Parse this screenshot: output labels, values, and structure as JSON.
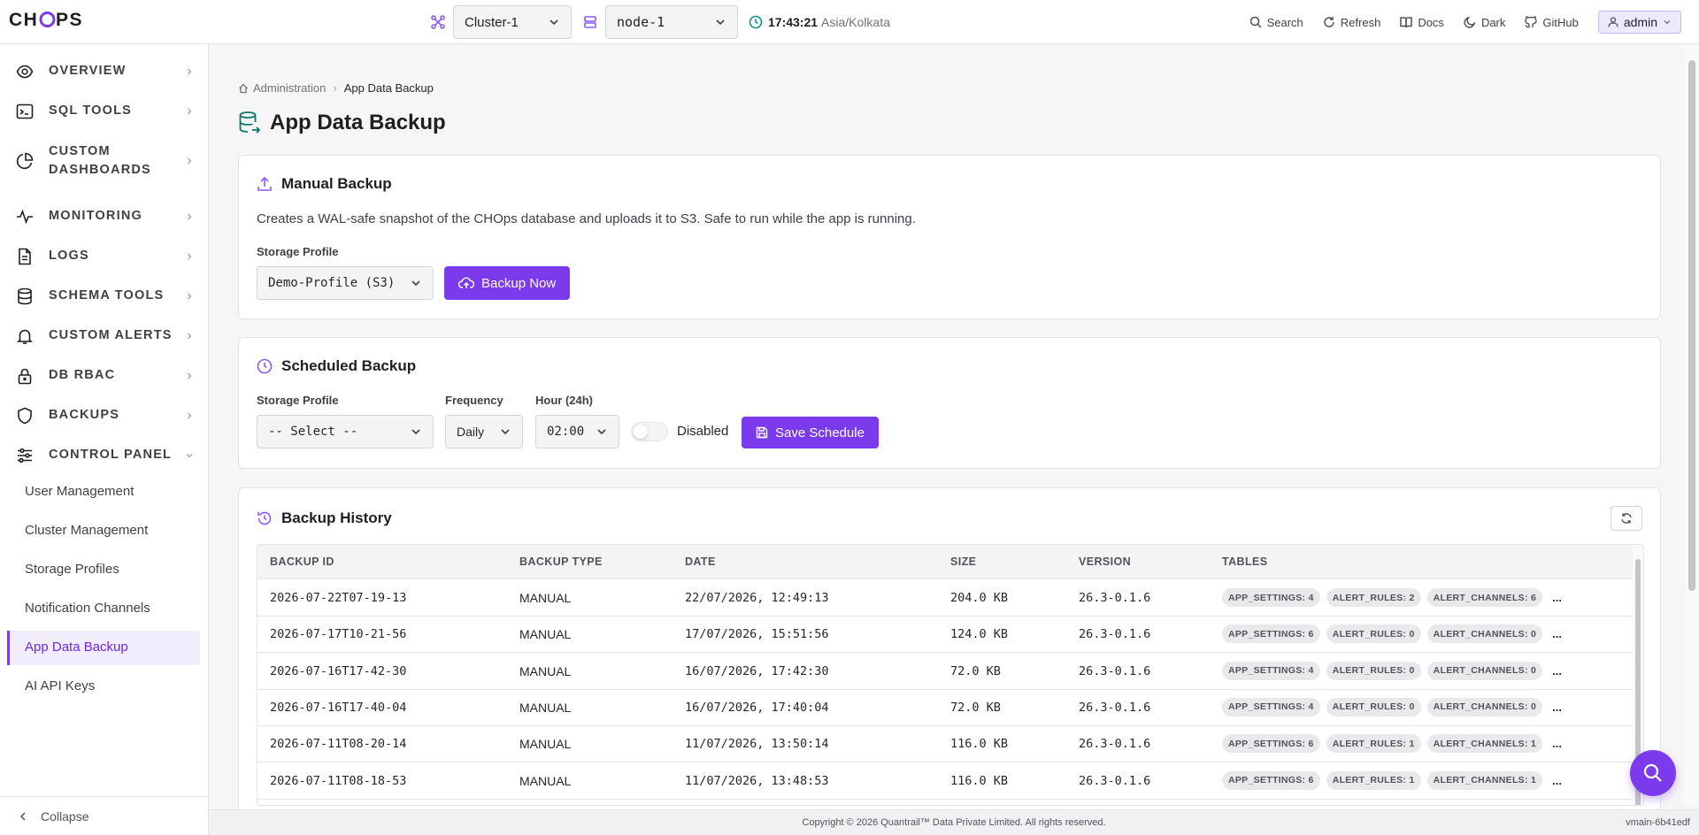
{
  "header": {
    "cluster_select": "Cluster-1",
    "node_select": "node-1",
    "time": "17:43:21",
    "timezone": "Asia/Kolkata",
    "links": {
      "search": "Search",
      "refresh": "Refresh",
      "docs": "Docs",
      "theme": "Dark",
      "github": "GitHub"
    },
    "user": "admin"
  },
  "sidebar": {
    "items": [
      {
        "label": "OVERVIEW",
        "icon": "eye-icon"
      },
      {
        "label": "SQL TOOLS",
        "icon": "terminal-icon"
      },
      {
        "label": "CUSTOM DASHBOARDS",
        "icon": "pie-chart-icon"
      },
      {
        "label": "MONITORING",
        "icon": "activity-icon"
      },
      {
        "label": "LOGS",
        "icon": "file-text-icon"
      },
      {
        "label": "SCHEMA TOOLS",
        "icon": "database-icon"
      },
      {
        "label": "CUSTOM ALERTS",
        "icon": "bell-icon"
      },
      {
        "label": "DB RBAC",
        "icon": "lock-icon"
      },
      {
        "label": "BACKUPS",
        "icon": "shield-icon"
      },
      {
        "label": "CONTROL PANEL",
        "icon": "sliders-icon"
      }
    ],
    "sub_items": [
      {
        "label": "User Management"
      },
      {
        "label": "Cluster Management"
      },
      {
        "label": "Storage Profiles"
      },
      {
        "label": "Notification Channels"
      },
      {
        "label": "App Data Backup"
      },
      {
        "label": "AI API Keys"
      }
    ],
    "collapse": "Collapse"
  },
  "breadcrumb": {
    "parent": "Administration",
    "current": "App Data Backup"
  },
  "page": {
    "title": "App Data Backup"
  },
  "manual": {
    "title": "Manual Backup",
    "description": "Creates a WAL-safe snapshot of the CHOps database and uploads it to S3. Safe to run while the app is running.",
    "storage_label": "Storage Profile",
    "storage_value": "Demo-Profile (S3)",
    "button": "Backup Now"
  },
  "scheduled": {
    "title": "Scheduled Backup",
    "storage_label": "Storage Profile",
    "storage_value": "-- Select --",
    "frequency_label": "Frequency",
    "frequency_value": "Daily",
    "hour_label": "Hour (24h)",
    "hour_value": "02:00",
    "toggle_label": "Disabled",
    "button": "Save Schedule"
  },
  "history": {
    "title": "Backup History",
    "columns": [
      "BACKUP ID",
      "BACKUP TYPE",
      "DATE",
      "SIZE",
      "VERSION",
      "TABLES"
    ],
    "rows": [
      {
        "id": "2026-07-22T07-19-13",
        "type": "MANUAL",
        "date": "22/07/2026, 12:49:13",
        "size": "204.0 KB",
        "version": "26.3-0.1.6",
        "tables": [
          "APP_SETTINGS: 4",
          "ALERT_RULES: 2",
          "ALERT_CHANNELS: 6"
        ],
        "more": "..."
      },
      {
        "id": "2026-07-17T10-21-56",
        "type": "MANUAL",
        "date": "17/07/2026, 15:51:56",
        "size": "124.0 KB",
        "version": "26.3-0.1.6",
        "tables": [
          "APP_SETTINGS: 6",
          "ALERT_RULES: 0",
          "ALERT_CHANNELS: 0"
        ],
        "more": "..."
      },
      {
        "id": "2026-07-16T17-42-30",
        "type": "MANUAL",
        "date": "16/07/2026, 17:42:30",
        "size": "72.0 KB",
        "version": "26.3-0.1.6",
        "tables": [
          "APP_SETTINGS: 4",
          "ALERT_RULES: 0",
          "ALERT_CHANNELS: 0"
        ],
        "more": "..."
      },
      {
        "id": "2026-07-16T17-40-04",
        "type": "MANUAL",
        "date": "16/07/2026, 17:40:04",
        "size": "72.0 KB",
        "version": "26.3-0.1.6",
        "tables": [
          "APP_SETTINGS: 4",
          "ALERT_RULES: 0",
          "ALERT_CHANNELS: 0"
        ],
        "more": "..."
      },
      {
        "id": "2026-07-11T08-20-14",
        "type": "MANUAL",
        "date": "11/07/2026, 13:50:14",
        "size": "116.0 KB",
        "version": "26.3-0.1.6",
        "tables": [
          "APP_SETTINGS: 6",
          "ALERT_RULES: 1",
          "ALERT_CHANNELS: 1"
        ],
        "more": "..."
      },
      {
        "id": "2026-07-11T08-18-53",
        "type": "MANUAL",
        "date": "11/07/2026, 13:48:53",
        "size": "116.0 KB",
        "version": "26.3-0.1.6",
        "tables": [
          "APP_SETTINGS: 6",
          "ALERT_RULES: 1",
          "ALERT_CHANNELS: 1"
        ],
        "more": "..."
      }
    ]
  },
  "footer": {
    "copyright": "Copyright © 2026 Quantrail™ Data Private Limited. All rights reserved.",
    "version": "vmain-6b41edf"
  },
  "colors": {
    "accent": "#7c3aed",
    "brand_teal": "#0f766e"
  }
}
